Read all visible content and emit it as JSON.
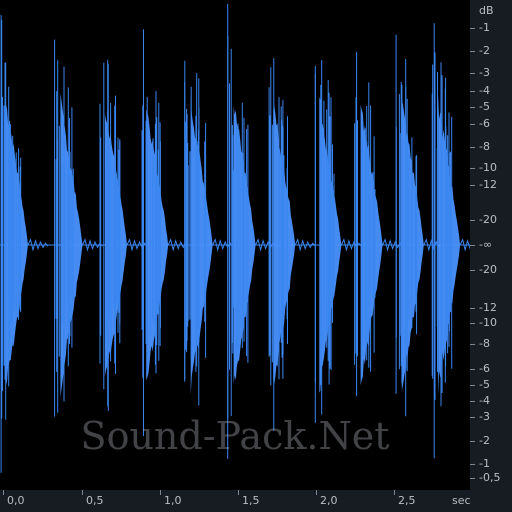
{
  "colors": {
    "waveform": "#3a86f0",
    "waveform_core": "#4a92ff",
    "background": "#000000",
    "ruler": "#171c22",
    "label": "#b9bec4"
  },
  "watermark": "Sound-Pack.Net",
  "db_ruler": {
    "unit": "dB",
    "labels": [
      "-1",
      "-2",
      "-3",
      "-4",
      "-5",
      "-6",
      "-8",
      "-10",
      "-12",
      "-20",
      "-∞",
      "-20",
      "-12",
      "-10",
      "-8",
      "-6",
      "-5",
      "-4",
      "-3",
      "-2",
      "-1",
      "-0,5"
    ]
  },
  "time_ruler": {
    "unit": "sec",
    "labels": [
      "0,0",
      "0,5",
      "1,0",
      "1,5",
      "2,0",
      "2,5"
    ]
  },
  "waveform": {
    "duration_sec": 2.85,
    "burst_start_sec": [
      0.0,
      0.33,
      0.6,
      0.85,
      1.12,
      1.38,
      1.62,
      1.9,
      2.15,
      2.4,
      2.62
    ]
  }
}
